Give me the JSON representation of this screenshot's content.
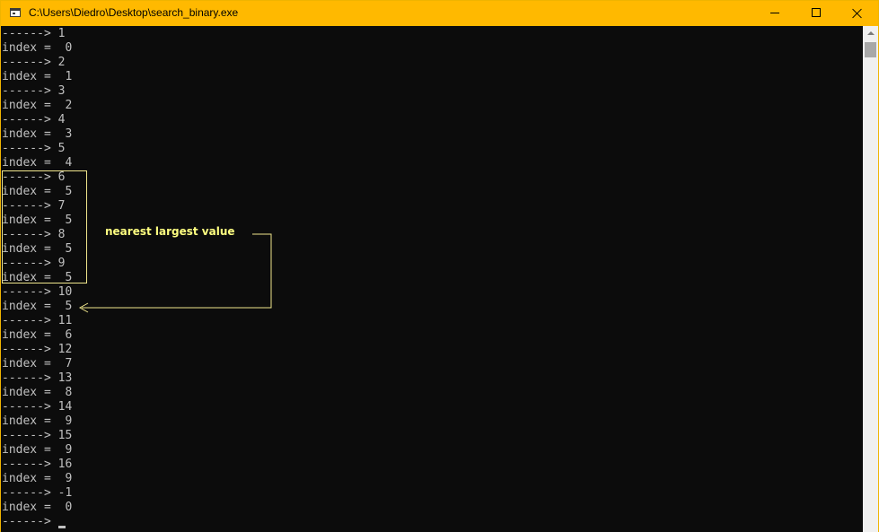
{
  "window": {
    "title": "C:\\Users\\Diedro\\Desktop\\search_binary.exe",
    "title_bar_color": "#ffb900",
    "controls": [
      "minimize-icon",
      "maximize-icon",
      "close-icon"
    ]
  },
  "console": {
    "text_color": "#c0c0c0",
    "background": "#0c0c0c",
    "lines": [
      "------> 1",
      "index =  0",
      "------> 2",
      "index =  1",
      "------> 3",
      "index =  2",
      "------> 4",
      "index =  3",
      "------> 5",
      "index =  4",
      "------> 6",
      "index =  5",
      "------> 7",
      "index =  5",
      "------> 8",
      "index =  5",
      "------> 9",
      "index =  5",
      "------> 10",
      "index =  5",
      "------> 11",
      "index =  6",
      "------> 12",
      "index =  7",
      "------> 13",
      "index =  8",
      "------> 14",
      "index =  9",
      "------> 15",
      "index =  9",
      "------> 16",
      "index =  9",
      "------> -1",
      "index =  0"
    ],
    "prompt": "------>"
  },
  "annotation": {
    "label": "nearest largest value",
    "color": "#ffff80"
  }
}
